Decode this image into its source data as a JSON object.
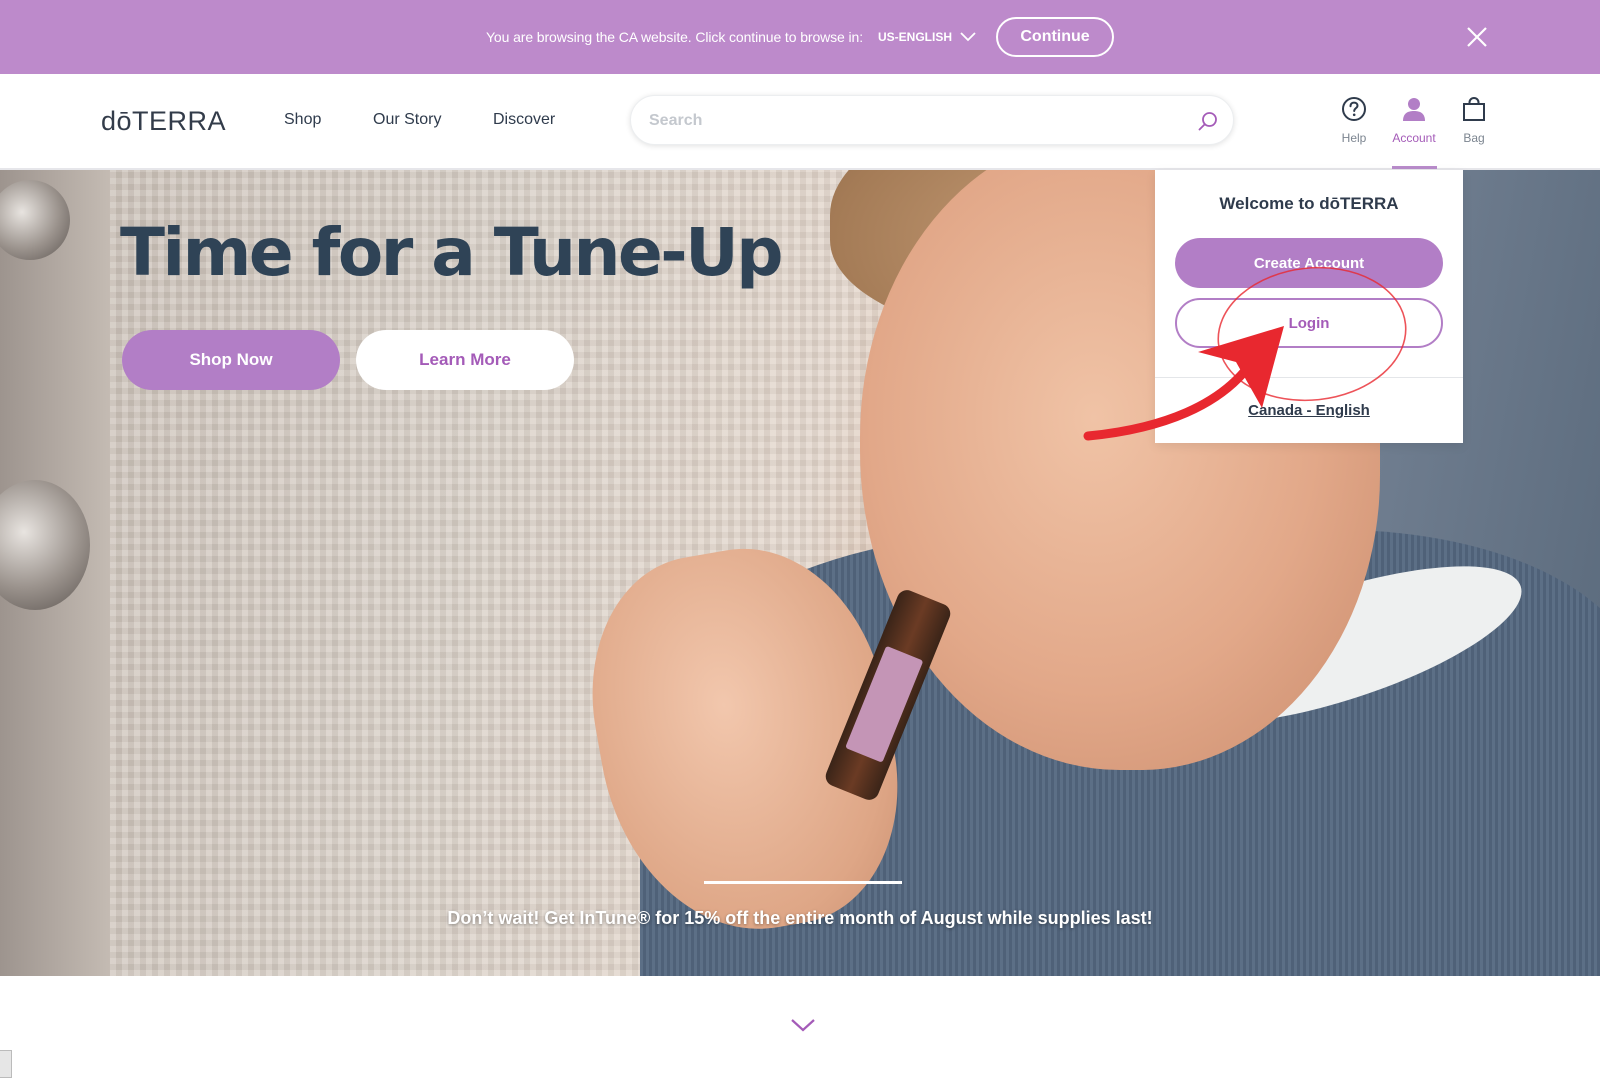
{
  "banner": {
    "message": "You are browsing the CA website. Click continue to browse in:",
    "locale": "US-ENGLISH",
    "continue_label": "Continue",
    "background": "#bd8acb"
  },
  "header": {
    "logo": "dōTERRA",
    "nav": [
      "Shop",
      "Our Story",
      "Discover"
    ],
    "search_placeholder": "Search",
    "icons": {
      "help": "Help",
      "account": "Account",
      "bag": "Bag"
    }
  },
  "hero": {
    "title": "Time for a Tune-Up",
    "shop_now": "Shop Now",
    "learn_more": "Learn More",
    "caption": "Don’t wait! Get InTune® for 15% off the entire month of August while supplies last!"
  },
  "account_dropdown": {
    "title": "Welcome to dōTERRA",
    "create_account": "Create Account",
    "login": "Login",
    "locale_link": "Canada - English"
  },
  "colors": {
    "accent": "#b27ec6",
    "accent_text": "#a45bb8",
    "heading": "#2f4356",
    "annotation": "#e8282f"
  }
}
